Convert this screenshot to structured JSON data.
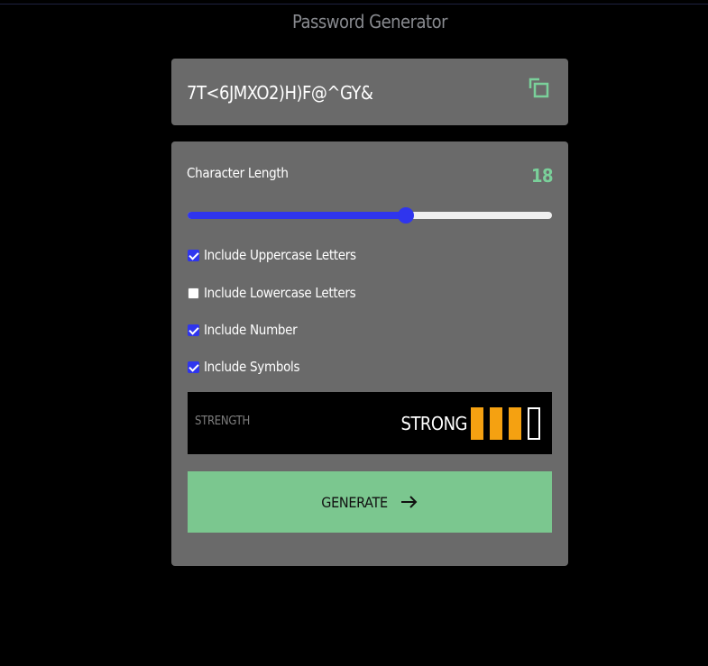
{
  "app": {
    "title": "Password Generator"
  },
  "password": {
    "value": "7T<6JMXO2)H)F@^GY&",
    "copy_icon": "copy-icon"
  },
  "settings": {
    "length_label": "Character Length",
    "length_value": "18",
    "slider": {
      "fraction": 0.6
    },
    "options": [
      {
        "label": "Include Uppercase Letters",
        "checked": true
      },
      {
        "label": "Include Lowercase Letters",
        "checked": false
      },
      {
        "label": "Include Number",
        "checked": true
      },
      {
        "label": "Include Symbols",
        "checked": true
      }
    ]
  },
  "strength": {
    "label": "STRENGTH",
    "value": "STRONG",
    "bars_filled": 3,
    "bars_total": 4
  },
  "generate": {
    "label": "GENERATE",
    "icon": "arrow-right-icon"
  },
  "colors": {
    "accent_green": "#7ad09a",
    "button_green": "#7bc78f",
    "slider_blue": "#2f35ee",
    "strength_orange": "#f5a111",
    "panel_gray": "#6a6a6a"
  }
}
